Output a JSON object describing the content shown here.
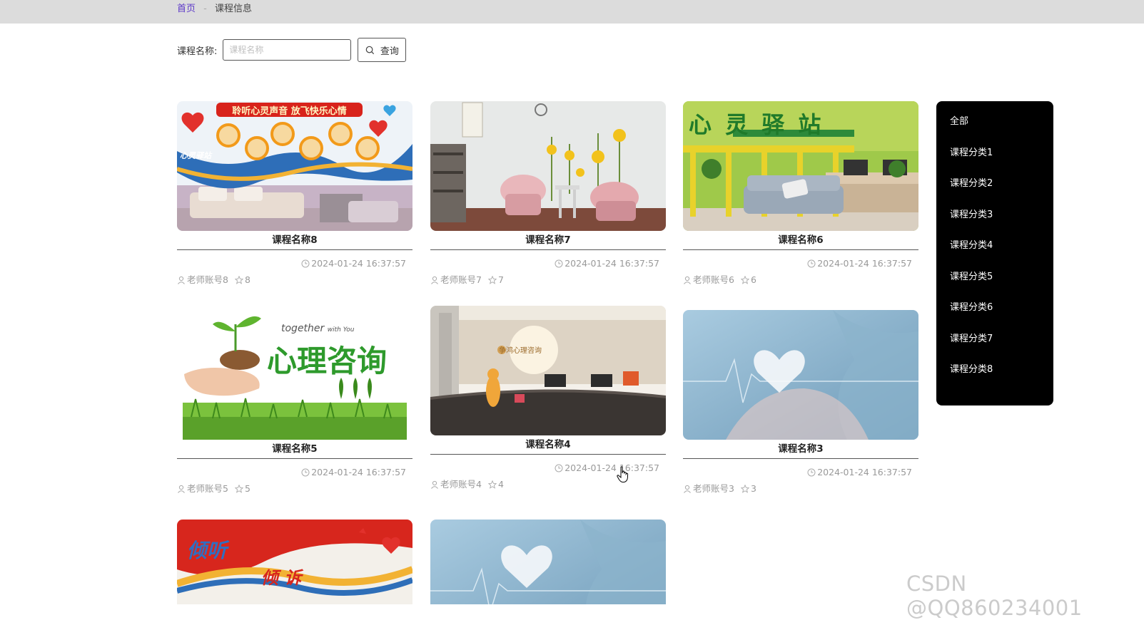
{
  "breadcrumb": {
    "home": "首页",
    "separator": "-",
    "current": "课程信息"
  },
  "search": {
    "label": "课程名称:",
    "placeholder": "课程名称",
    "value": "",
    "button_label": "查询"
  },
  "courses": [
    {
      "title": "课程名称8",
      "time": "2024-01-24 16:37:57",
      "teacher": "老师账号8",
      "stars": "8"
    },
    {
      "title": "课程名称7",
      "time": "2024-01-24 16:37:57",
      "teacher": "老师账号7",
      "stars": "7"
    },
    {
      "title": "课程名称6",
      "time": "2024-01-24 16:37:57",
      "teacher": "老师账号6",
      "stars": "6"
    },
    {
      "title": "课程名称5",
      "time": "2024-01-24 16:37:57",
      "teacher": "老师账号5",
      "stars": "5"
    },
    {
      "title": "课程名称4",
      "time": "2024-01-24 16:37:57",
      "teacher": "老师账号4",
      "stars": "4"
    },
    {
      "title": "课程名称3",
      "time": "2024-01-24 16:37:57",
      "teacher": "老师账号3",
      "stars": "3"
    },
    {
      "title": "",
      "time": "",
      "teacher": "",
      "stars": ""
    },
    {
      "title": "",
      "time": "",
      "teacher": "",
      "stars": ""
    }
  ],
  "thumb_text": {
    "c8_banner": "聆听心灵声音 放飞快乐心情",
    "c8_logo": "心灵驿站",
    "c6_banner": "心 灵 驿 站",
    "c5_english": "together",
    "c5_english_small": "with You",
    "c5_main": "心理咨询",
    "c4_logo": "争鸿心理咨询",
    "c2_main": "倾听",
    "c2_sub": "倾 诉"
  },
  "categories": [
    {
      "label": "全部"
    },
    {
      "label": "课程分类1"
    },
    {
      "label": "课程分类2"
    },
    {
      "label": "课程分类3"
    },
    {
      "label": "课程分类4"
    },
    {
      "label": "课程分类5"
    },
    {
      "label": "课程分类6"
    },
    {
      "label": "课程分类7"
    },
    {
      "label": "课程分类8"
    }
  ],
  "watermark": "CSDN @QQ860234001",
  "colors": {
    "accent": "#5b37c8",
    "topbar": "#dcdcdc",
    "menu_bg": "#000000"
  }
}
